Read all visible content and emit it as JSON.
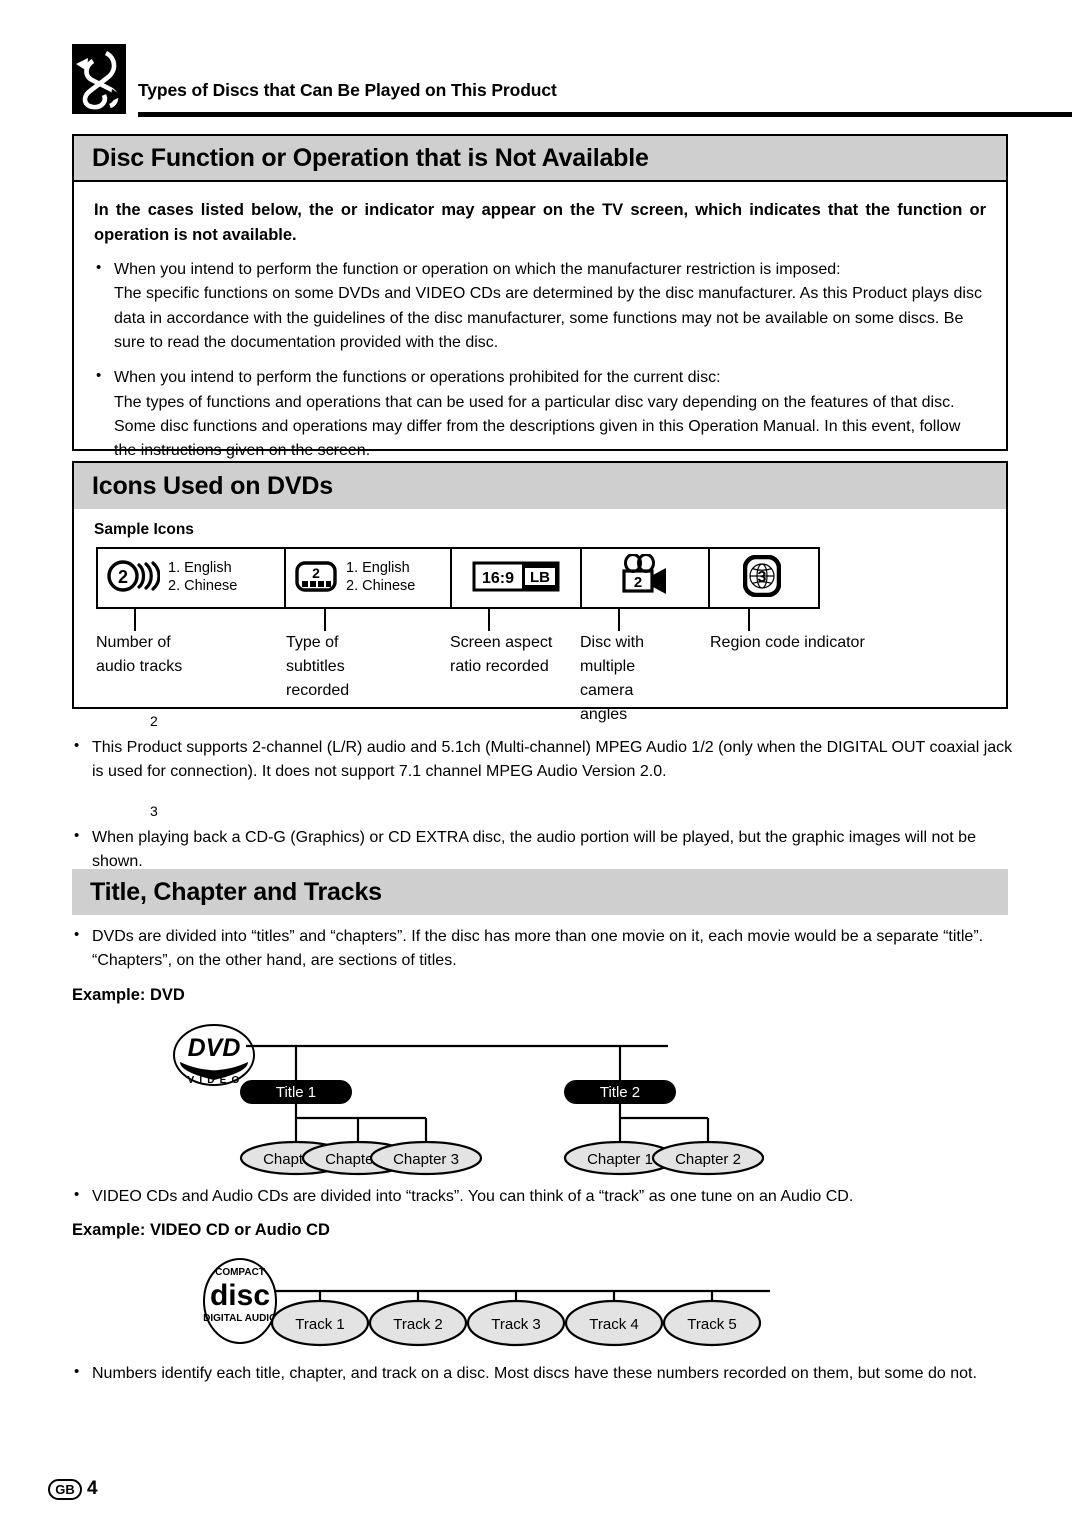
{
  "running_head": {
    "title": "Types of Discs that Can Be Played on This Product",
    "mark_icon": "chain-link-logo-icon"
  },
  "section_not_available": {
    "heading": "Disc Function or Operation that is Not Available",
    "lead": "In the cases listed below, the  or  indicator may appear on the TV screen, which indicates that the function or operation is not available.",
    "bullets": [
      {
        "line1": "When you intend to perform the function or operation on which the manufacturer restriction is imposed:",
        "line2": "The specific functions on some DVDs and VIDEO CDs are determined by the disc manufacturer. As this Product plays disc data in accordance with the guidelines of the disc manufacturer, some functions may not be available on some discs. Be sure to read the documentation provided with the disc."
      },
      {
        "line1": "When you intend to perform the functions or operations prohibited for the current disc:",
        "line2": "The types of functions and operations that can be used for a particular disc vary depending on the features of that disc. Some disc functions and operations may differ from the descriptions given in this Operation Manual. In this event, follow the instructions given on the screen."
      }
    ]
  },
  "section_icons": {
    "heading": "Icons Used on DVDs",
    "sample_label": "Sample Icons",
    "icons": [
      {
        "icon_name": "audio-tracks-icon",
        "value": "2",
        "langs": [
          "1. English",
          "2. Chinese"
        ],
        "caption": "Number of audio tracks"
      },
      {
        "icon_name": "subtitles-icon",
        "value": "2",
        "langs": [
          "1. English",
          "2. Chinese"
        ],
        "caption": "Type of subtitles recorded"
      },
      {
        "icon_name": "aspect-ratio-icon",
        "value": "16:9",
        "value2": "LB",
        "langs": [],
        "caption": "Screen aspect ratio recorded"
      },
      {
        "icon_name": "multi-angle-camera-icon",
        "value": "2",
        "langs": [],
        "caption": "Disc with multiple camera angles"
      },
      {
        "icon_name": "region-code-globe-icon",
        "value": "3",
        "langs": [],
        "caption": "Region code indicator"
      }
    ]
  },
  "footnotes": [
    {
      "marker": "2",
      "text": "This Product supports 2-channel (L/R) audio and 5.1ch (Multi-channel) MPEG Audio 1/2 (only when the DIGITAL OUT coaxial jack is used for connection). It does not support 7.1 channel MPEG Audio Version 2.0."
    },
    {
      "marker": "3",
      "text": "When playing back a CD-G (Graphics) or CD EXTRA disc, the audio portion will be played, but the graphic images will not be shown."
    }
  ],
  "section_title_chapter": {
    "heading": "Title, Chapter and Tracks",
    "bullet_dvd": "DVDs are divided into “titles” and “chapters”. If the disc has more than one movie on it, each movie would be a separate “title”. “Chapters”, on the other hand, are sections of titles.",
    "example_dvd_label": "Example: DVD",
    "dvd_logo": {
      "line1": "DVD",
      "line2": "V I D E O"
    },
    "titles": [
      {
        "label": "Title 1",
        "chapters": [
          "Chapter 1",
          "Chapter 2",
          "Chapter 3"
        ]
      },
      {
        "label": "Title 2",
        "chapters": [
          "Chapter 1",
          "Chapter 2"
        ]
      }
    ],
    "bullet_cd": "VIDEO CDs and Audio CDs are divided into “tracks”. You can think of a “track” as one tune on an Audio CD.",
    "example_cd_label": "Example: VIDEO CD or Audio CD",
    "cd_logo": {
      "top": "COMPACT",
      "middle": "disc",
      "bottom": "DIGITAL AUDIO"
    },
    "tracks": [
      "Track 1",
      "Track 2",
      "Track 3",
      "Track 4",
      "Track 5"
    ],
    "bullet_numbers": "Numbers identify each title, chapter, and track on a disc. Most discs have these numbers recorded on them, but some do not."
  },
  "footer": {
    "region_badge": "GB",
    "page_number": "4"
  },
  "colors": {
    "heading_bar": "#cfcfcf",
    "node_fill": "#e3e3e3",
    "ink": "#000000"
  }
}
